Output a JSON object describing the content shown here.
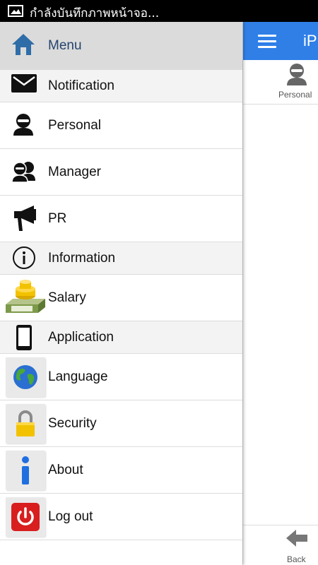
{
  "status_bar": {
    "notification_text": "กำลังบันทึกภาพหน้าจอ...",
    "icon": "image-icon"
  },
  "drawer": {
    "header": {
      "label": "Menu",
      "icon": "home-icon"
    },
    "items": [
      {
        "label": "Notification",
        "icon": "envelope-icon",
        "type": "section"
      },
      {
        "label": "Personal",
        "icon": "person-icon",
        "type": "item"
      },
      {
        "label": "Manager",
        "icon": "people-icon",
        "type": "item"
      },
      {
        "label": "PR",
        "icon": "megaphone-icon",
        "type": "item"
      },
      {
        "label": "Information",
        "icon": "info-icon",
        "type": "section"
      },
      {
        "label": "Salary",
        "icon": "money-icon",
        "type": "item"
      },
      {
        "label": "Application",
        "icon": "phone-icon",
        "type": "section"
      },
      {
        "label": "Language",
        "icon": "globe-icon",
        "type": "item"
      },
      {
        "label": "Security",
        "icon": "lock-icon",
        "type": "item"
      },
      {
        "label": "About",
        "icon": "info-i-icon",
        "type": "item"
      },
      {
        "label": "Log out",
        "icon": "power-icon",
        "type": "item"
      }
    ]
  },
  "app": {
    "title": "iP",
    "tab_label": "Personal",
    "back_label": "Back",
    "accent_color": "#2f7fe7"
  }
}
